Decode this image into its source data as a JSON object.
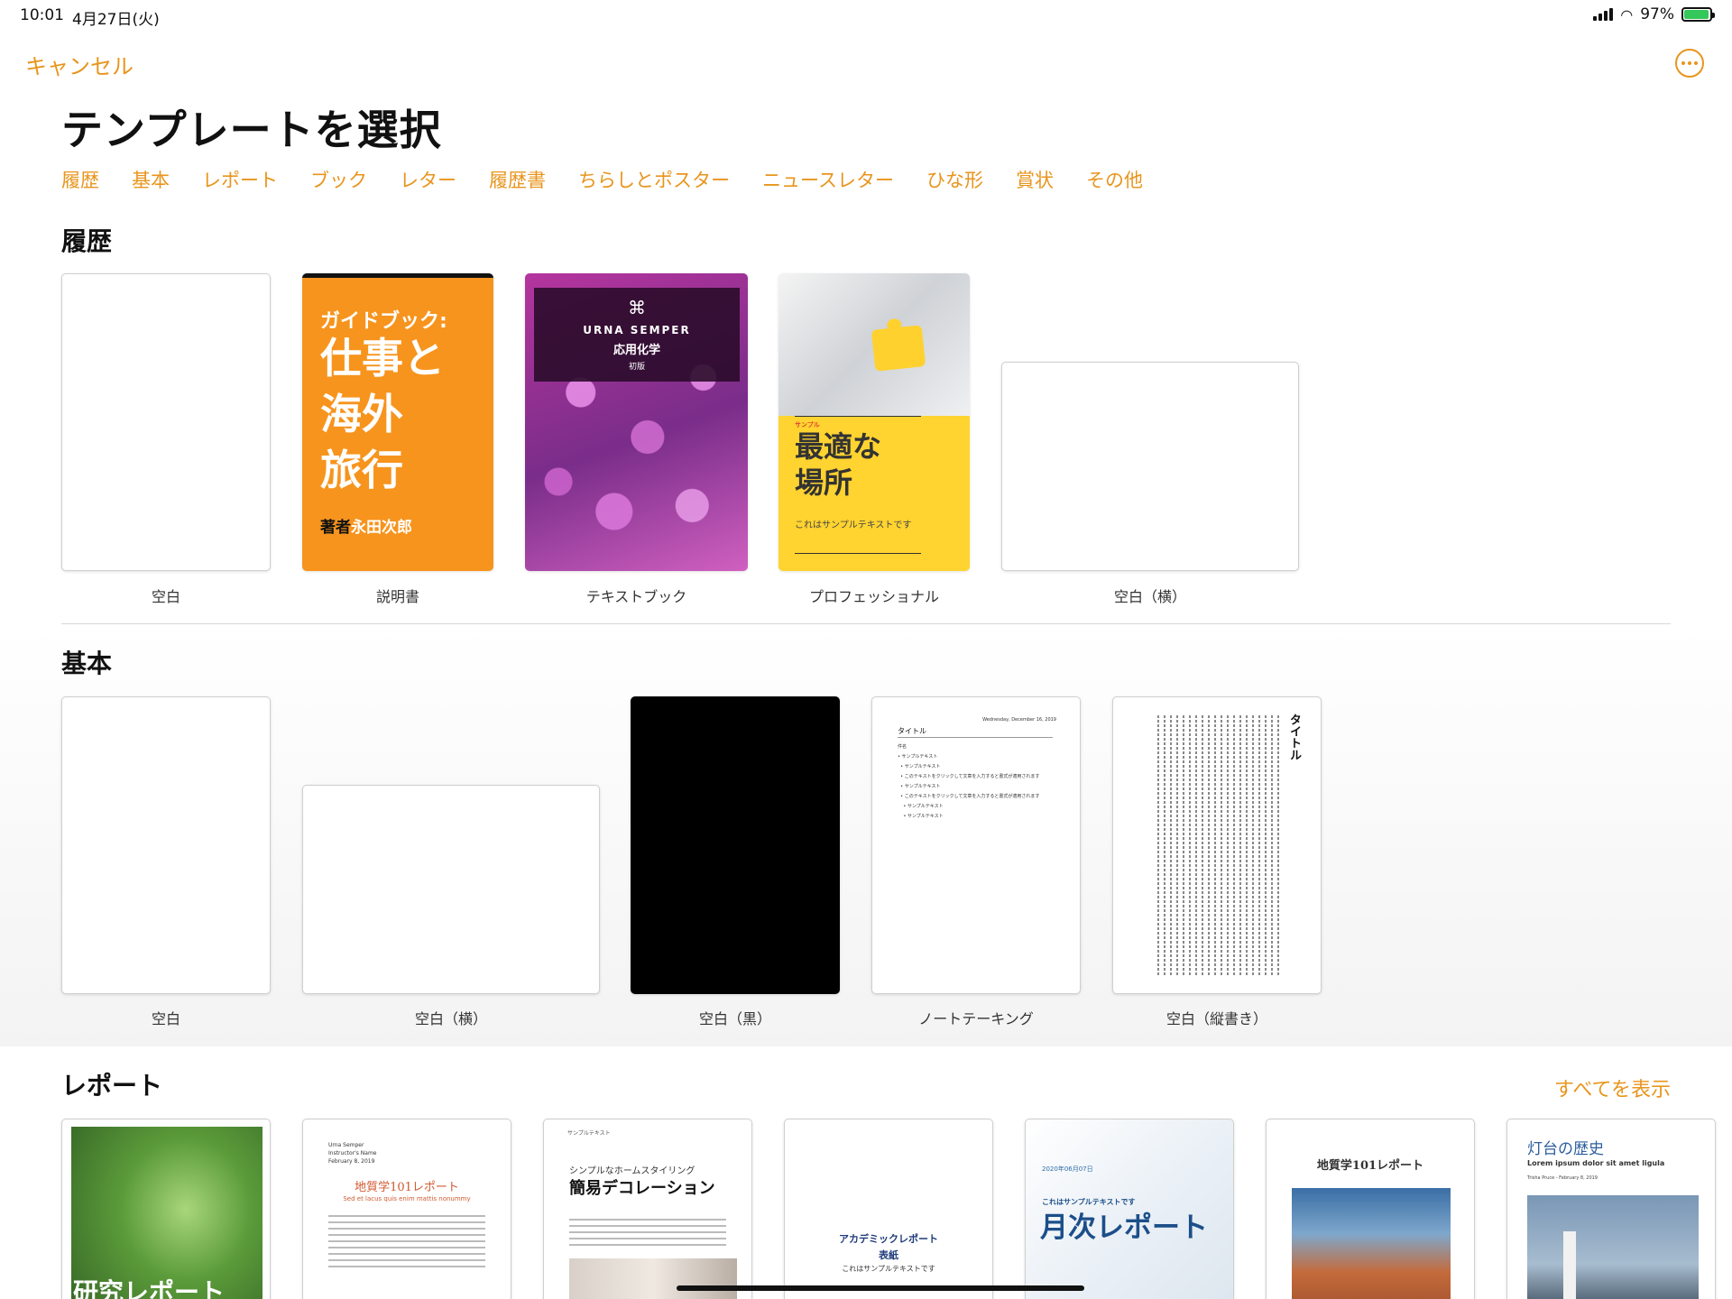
{
  "status_bar": {
    "time": "10:01",
    "date": "4月27日(火)",
    "battery_percent": "97%",
    "battery_level": 0.97
  },
  "header": {
    "cancel_label": "キャンセル",
    "more_icon": "ellipsis-circle-icon",
    "title": "テンプレートを選択"
  },
  "colors": {
    "accent": "#e8951d"
  },
  "categories": [
    "履歴",
    "基本",
    "レポート",
    "ブック",
    "レター",
    "履歴書",
    "ちらしとポスター",
    "ニュースレター",
    "ひな形",
    "賞状",
    "その他"
  ],
  "sections": {
    "recent": {
      "title": "履歴",
      "items": [
        {
          "caption": "空白"
        },
        {
          "caption": "説明書",
          "cover": {
            "line1": "ガイドブック:",
            "line2": "仕事と\n海外\n旅行",
            "author_label": "著者",
            "author": "永田次郎"
          }
        },
        {
          "caption": "テキストブック",
          "cover": {
            "symbol": "⌘",
            "line1": "URNA SEMPER",
            "line2": "応用化学",
            "line3": "初版"
          }
        },
        {
          "caption": "プロフェッショナル",
          "cover": {
            "small": "サンプル",
            "big": "最適な\n場所",
            "sub": "これはサンプルテキストです"
          }
        },
        {
          "caption": "空白（横）"
        }
      ]
    },
    "basic": {
      "title": "基本",
      "items": [
        {
          "caption": "空白"
        },
        {
          "caption": "空白（横）"
        },
        {
          "caption": "空白（黒）"
        },
        {
          "caption": "ノートテーキング",
          "cover": {
            "date": "Wednesday, December 16, 2019",
            "title": "タイトル",
            "lines": "件名\n• サンプルテキスト\n  • サンプルテキスト\n  • このテキストをクリックして文章を入力すると書式が適用されます\n  • サンプルテキスト\n  • このテキストをクリックして文章を入力すると書式が適用されます\n    • サンプルテキスト\n    • サンプルテキスト"
          }
        },
        {
          "caption": "空白（縦書き）",
          "cover": {
            "title": "タイトル"
          }
        }
      ]
    },
    "reports": {
      "title": "レポート",
      "show_all_label": "すべてを表示",
      "items": [
        {
          "cover": {
            "title": "研究レポート"
          }
        },
        {
          "cover": {
            "name": "Urna Semper\nInstructor's Name\nFebruary 8, 2019",
            "title": "地質学101レポート",
            "subtitle": "Sed et lacus quis enim mattis nonummy"
          }
        },
        {
          "cover": {
            "tag": "サンプルテキスト",
            "subtitle": "シンプルなホームスタイリング",
            "title": "簡易デコレーション"
          }
        },
        {
          "cover": {
            "title": "アカデミックレポート",
            "subtitle": "表紙",
            "note": "これはサンプルテキストです"
          }
        },
        {
          "cover": {
            "date": "2020年06月07日",
            "subtitle": "これはサンプルテキストです",
            "title": "月次レポート"
          }
        },
        {
          "cover": {
            "title": "地質学101レポート"
          }
        },
        {
          "cover": {
            "title": "灯台の歴史",
            "subtitle": "Lorem ipsum dolor sit amet ligula",
            "date": "Trisha Pruce - February 8, 2019"
          }
        }
      ]
    }
  }
}
